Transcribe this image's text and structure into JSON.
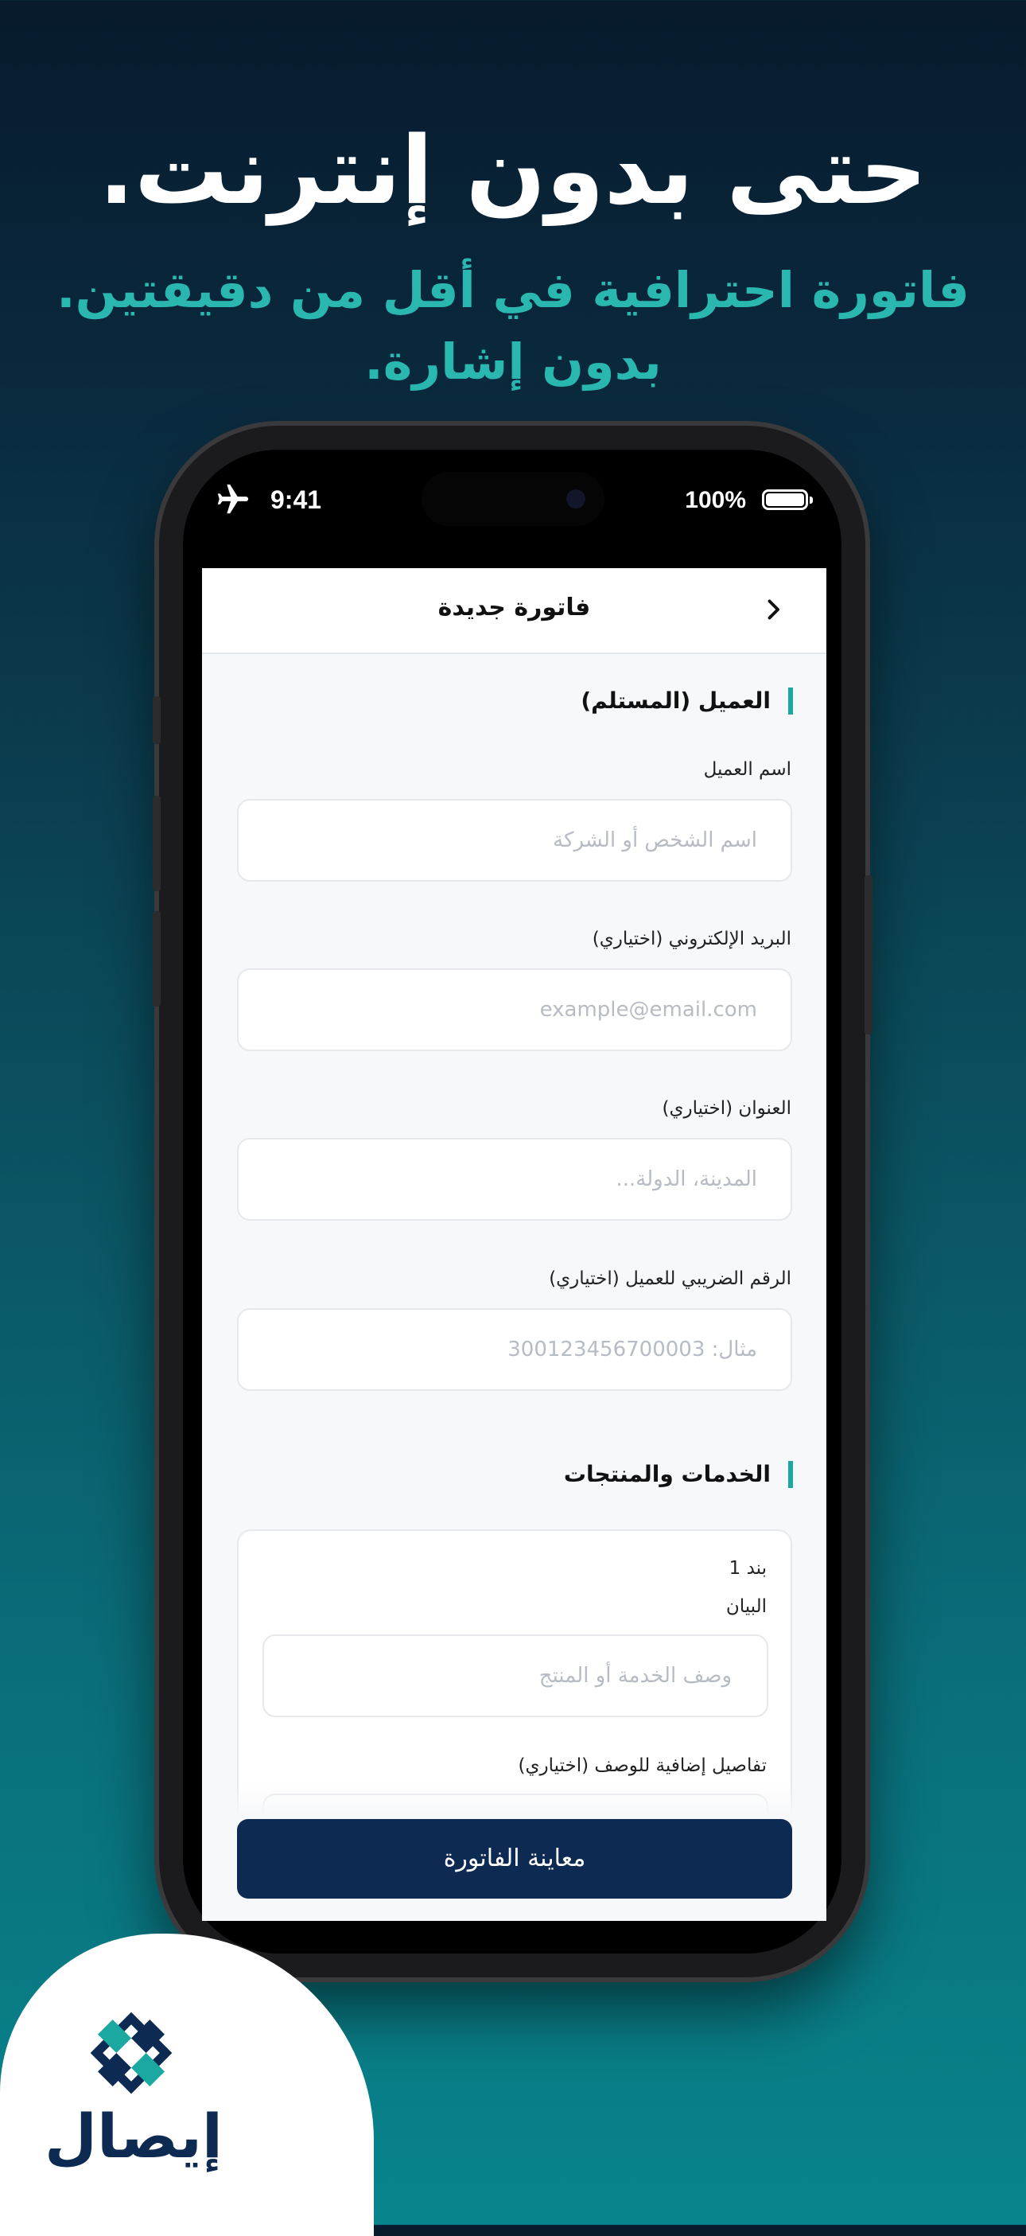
{
  "hero": {
    "headline": "حتى بدون إنترنت.",
    "subline_1": "فاتورة احترافية في أقل من دقيقتين.",
    "subline_2": "بدون إشارة."
  },
  "status_bar": {
    "time": "9:41",
    "battery": "100%",
    "airplane_icon": "airplane-icon"
  },
  "navbar": {
    "title": "فاتورة جديدة",
    "back_icon": "chevron-icon"
  },
  "client_section": {
    "title": "العميل (المستلم)",
    "fields": [
      {
        "label": "اسم العميل",
        "placeholder": "اسم الشخص أو الشركة"
      },
      {
        "label": "البريد الإلكتروني (اختياري)",
        "placeholder": "example@email.com"
      },
      {
        "label": "العنوان (اختياري)",
        "placeholder": "المدينة، الدولة..."
      },
      {
        "label": "الرقم الضريبي للعميل (اختياري)",
        "placeholder": "مثال: 300123456700003"
      }
    ]
  },
  "items_section": {
    "title": "الخدمات والمنتجات",
    "item": {
      "heading": "بند 1",
      "description_label": "البيان",
      "description_placeholder": "وصف الخدمة أو المنتج",
      "details_label": "تفاصيل إضافية للوصف (اختياري)"
    }
  },
  "actions": {
    "preview_button": "معاينة الفاتورة"
  },
  "brand": {
    "name": "إيصال",
    "colors": {
      "navy": "#0c2a52",
      "teal": "#1aa8a0"
    }
  }
}
